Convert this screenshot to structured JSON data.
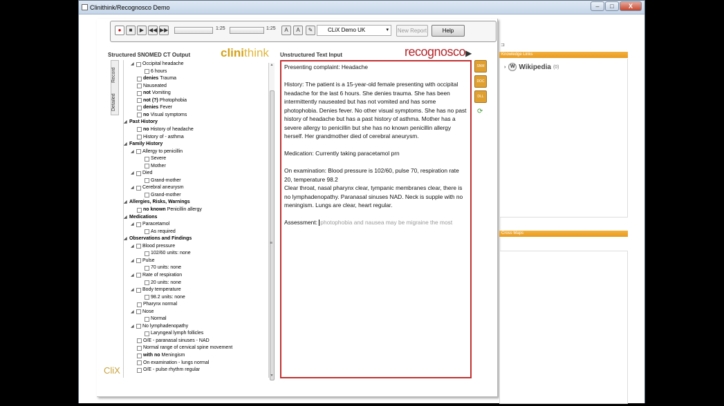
{
  "window": {
    "title": "Clinithink/Recognosco Demo",
    "minimize": "–",
    "maximize": "□",
    "close": "X"
  },
  "toolbar": {
    "record": "●",
    "stop": "■",
    "play": "▶",
    "rewind": "◀◀",
    "forward": "▶▶",
    "time_left": "1:25",
    "time_right": "1:25",
    "font_up": "A",
    "font_down": "A",
    "language": "CLiX Demo UK",
    "new_report": "New Report",
    "help": "Help"
  },
  "left_panel": {
    "title": "Structured SNOMED CT Output",
    "logo_part1": "clini",
    "logo_part2": "think",
    "tab_record": "Record",
    "tab_detailed": "Detailed",
    "footer_logo": "CliX",
    "grip": "≡"
  },
  "tree": [
    {
      "level": 1,
      "toggle": "◢",
      "check": true,
      "text": "Occipital headache"
    },
    {
      "level": 2,
      "check": true,
      "text": "6 hours"
    },
    {
      "level": 1,
      "check": true,
      "mod": "denies",
      "text": "Trauma"
    },
    {
      "level": 1,
      "check": true,
      "text": "Nauseated"
    },
    {
      "level": 1,
      "check": true,
      "mod": "not",
      "text": "Vomiting"
    },
    {
      "level": 1,
      "check": true,
      "mod": "not (?)",
      "text": "Photophobia"
    },
    {
      "level": 1,
      "check": true,
      "mod": "denies",
      "text": "Fever"
    },
    {
      "level": 1,
      "check": true,
      "mod": "no",
      "text": "Visual symptoms"
    },
    {
      "level": 0,
      "toggle": "◢",
      "header": true,
      "text": "Past History"
    },
    {
      "level": 1,
      "check": true,
      "mod": "no",
      "text": "History of headache"
    },
    {
      "level": 1,
      "check": true,
      "text": "History of - asthma"
    },
    {
      "level": 0,
      "toggle": "◢",
      "header": true,
      "text": "Family History"
    },
    {
      "level": 1,
      "toggle": "◢",
      "check": true,
      "text": "Allergy to penicillin"
    },
    {
      "level": 2,
      "check": true,
      "text": "Severe"
    },
    {
      "level": 2,
      "check": true,
      "text": "Mother"
    },
    {
      "level": 1,
      "toggle": "◢",
      "check": true,
      "text": "Died"
    },
    {
      "level": 2,
      "check": true,
      "text": "Grand-mother"
    },
    {
      "level": 1,
      "toggle": "◢",
      "check": true,
      "text": "Cerebral aneurysm"
    },
    {
      "level": 2,
      "check": true,
      "text": "Grand-mother"
    },
    {
      "level": 0,
      "toggle": "◢",
      "header": true,
      "text": "Allergies, Risks, Warnings"
    },
    {
      "level": 1,
      "check": true,
      "mod": "no known",
      "text": "Penicillin allergy"
    },
    {
      "level": 0,
      "toggle": "◢",
      "header": true,
      "text": "Medications"
    },
    {
      "level": 1,
      "toggle": "◢",
      "check": true,
      "text": "Paracetamol"
    },
    {
      "level": 2,
      "check": true,
      "text": "As required"
    },
    {
      "level": 0,
      "toggle": "◢",
      "header": true,
      "text": "Observations and Findings"
    },
    {
      "level": 1,
      "toggle": "◢",
      "check": true,
      "text": "Blood pressure"
    },
    {
      "level": 2,
      "check": true,
      "text": "102/60 units: none"
    },
    {
      "level": 1,
      "toggle": "◢",
      "check": true,
      "text": "Pulse"
    },
    {
      "level": 2,
      "check": true,
      "text": "70 units: none"
    },
    {
      "level": 1,
      "toggle": "◢",
      "check": true,
      "text": "Rate of respiration"
    },
    {
      "level": 2,
      "check": true,
      "text": "20 units: none"
    },
    {
      "level": 1,
      "toggle": "◢",
      "check": true,
      "text": "Body temperature"
    },
    {
      "level": 2,
      "check": true,
      "text": "98.2 units: none"
    },
    {
      "level": 1,
      "check": true,
      "text": "Pharynx normal"
    },
    {
      "level": 1,
      "toggle": "◢",
      "check": true,
      "text": "Nose"
    },
    {
      "level": 2,
      "check": true,
      "text": "Normal"
    },
    {
      "level": 1,
      "toggle": "◢",
      "check": true,
      "text": "No lymphadenopathy"
    },
    {
      "level": 2,
      "check": true,
      "text": "Laryngeal lymph follicles"
    },
    {
      "level": 1,
      "check": true,
      "text": "O/E - paranasal sinuses - NAD"
    },
    {
      "level": 1,
      "check": true,
      "text": "Normal range of cervical spine movement"
    },
    {
      "level": 1,
      "check": true,
      "mod": "with no",
      "text": "Meningism"
    },
    {
      "level": 1,
      "check": true,
      "text": "On examination - lungs normal"
    },
    {
      "level": 1,
      "check": true,
      "text": "O/E - pulse rhythm regular"
    }
  ],
  "center_panel": {
    "title": "Unstructured Text Input",
    "logo": "recognosco",
    "logo_arrow": "▶",
    "paragraphs": [
      "Presenting complaint: Headache",
      "History: The patient is a 15-year-old female presenting with occipital headache for the last 6 hours. She denies trauma. She has been intermittently nauseated but has not vomited and has some photophobia. Denies fever. No other visual symptoms. She has no past history of headache but has a past history of asthma. Mother has a severe allergy to penicillin but she has no known penicillin allergy herself. Her grandmother died of cerebral aneurysm.",
      "Medication: Currently taking paracetamol prn",
      "On examination: Blood pressure is 102/60, pulse 70, respiration rate 20, temperature 98.2\nClear throat, nasal pharynx clear, tympanic membranes clear, there is no lymphadenopathy. Paranasal sinuses NAD. Neck is supple with no meningism. Lungs are clear, heart regular."
    ],
    "assessment_label": "Assessment:",
    "assessment_suggestion": "photophobia and nausea may be migraine the most",
    "side_buttons": [
      "SNM",
      "DOC",
      "DLL"
    ],
    "refresh": "⟳"
  },
  "right_panel": {
    "pin": "⊐",
    "knowledge_links_title": "Knowledge Links",
    "wikipedia_label": "Wikipedia",
    "wikipedia_count": "(0)",
    "wiki_icon": "W",
    "expand": "›",
    "cross_maps_title": "Cross Maps"
  },
  "colors": {
    "accent_orange": "#e89a20",
    "text_border_red": "#c23030",
    "clinithink_gold": "#d4a117",
    "recognosco_red": "#b3272c"
  }
}
